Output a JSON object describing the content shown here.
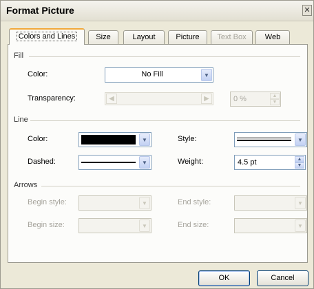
{
  "window": {
    "title": "Format Picture",
    "close_glyph": "✕"
  },
  "tabs": [
    {
      "label": "Colors and Lines",
      "active": true
    },
    {
      "label": "Size"
    },
    {
      "label": "Layout"
    },
    {
      "label": "Picture"
    },
    {
      "label": "Text Box",
      "disabled": true
    },
    {
      "label": "Web"
    }
  ],
  "fill": {
    "section_label": "Fill",
    "color_label": "Color:",
    "color_value": "No Fill",
    "transparency_label": "Transparency:",
    "transparency_value": "0 %"
  },
  "line": {
    "section_label": "Line",
    "color_label": "Color:",
    "color_value": "#000000",
    "dashed_label": "Dashed:",
    "style_label": "Style:",
    "weight_label": "Weight:",
    "weight_value": "4.5 pt"
  },
  "arrows": {
    "section_label": "Arrows",
    "begin_style_label": "Begin style:",
    "begin_size_label": "Begin size:",
    "end_style_label": "End style:",
    "end_size_label": "End size:"
  },
  "buttons": {
    "ok": "OK",
    "cancel": "Cancel"
  }
}
